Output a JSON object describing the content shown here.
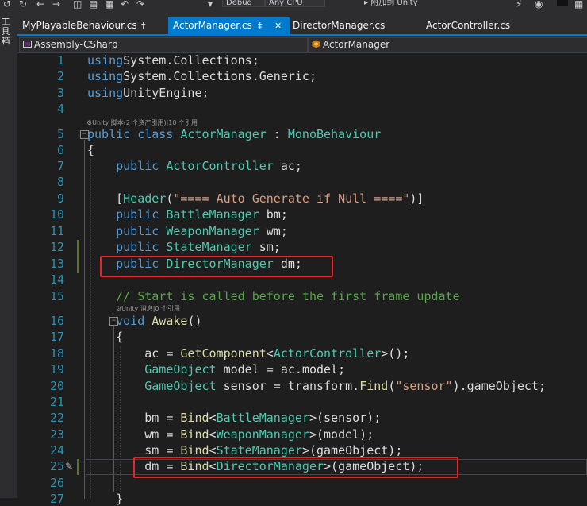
{
  "toolbar": {
    "config_value": "Debug",
    "platform_value": "Any CPU",
    "attach_label": "▸ 附加到 Unity"
  },
  "left_toolbox_label": "工具箱",
  "tabs": [
    {
      "label": "MyPlayableBehaviour.cs",
      "pin": "†",
      "active": false
    },
    {
      "label": "ActorManager.cs",
      "pin": "‡",
      "close": "✕",
      "active": true
    },
    {
      "label": "DirectorManager.cs",
      "active": false
    },
    {
      "label": "ActorController.cs",
      "active": false
    }
  ],
  "navbar": {
    "project": "Assembly-CSharp",
    "class": "ActorManager"
  },
  "codelens": {
    "class_refs": "⚙Unity 脚本(2 个资产引用)|10 个引用",
    "method_refs": "⚙Unity 消息|0 个引用"
  },
  "lines": [
    {
      "n": "1",
      "tokens": [
        [
          "kw",
          "using"
        ],
        [
          "",
          "System.Collections;"
        ]
      ]
    },
    {
      "n": "2",
      "tokens": [
        [
          "kw",
          "using"
        ],
        [
          "",
          "System.Collections.Generic;"
        ]
      ]
    },
    {
      "n": "3",
      "tokens": [
        [
          "kw",
          "using"
        ],
        [
          "",
          "UnityEngine;"
        ]
      ]
    },
    {
      "n": "4",
      "tokens": []
    },
    {
      "n": "5",
      "tokens": [
        [
          "kw",
          "public class"
        ],
        [
          "",
          " "
        ],
        [
          "ty",
          "ActorManager"
        ],
        [
          "",
          " : "
        ],
        [
          "ty",
          "MonoBehaviour"
        ]
      ]
    },
    {
      "n": "6",
      "tokens": [
        [
          "",
          "{"
        ]
      ]
    },
    {
      "n": "7",
      "tokens": [
        [
          "",
          "    "
        ],
        [
          "kw",
          "public"
        ],
        [
          "",
          " "
        ],
        [
          "ty",
          "ActorController"
        ],
        [
          "",
          " ac;"
        ]
      ]
    },
    {
      "n": "8",
      "tokens": []
    },
    {
      "n": "9",
      "tokens": [
        [
          "",
          "    ["
        ],
        [
          "ty",
          "Header"
        ],
        [
          "",
          "("
        ],
        [
          "st",
          "\"==== Auto Generate if Null ====\""
        ],
        [
          "",
          ")]"
        ]
      ]
    },
    {
      "n": "10",
      "tokens": [
        [
          "",
          "    "
        ],
        [
          "kw",
          "public"
        ],
        [
          "",
          " "
        ],
        [
          "ty",
          "BattleManager"
        ],
        [
          "",
          " bm;"
        ]
      ]
    },
    {
      "n": "11",
      "tokens": [
        [
          "",
          "    "
        ],
        [
          "kw",
          "public"
        ],
        [
          "",
          " "
        ],
        [
          "ty",
          "WeaponManager"
        ],
        [
          "",
          " wm;"
        ]
      ]
    },
    {
      "n": "12",
      "tokens": [
        [
          "",
          "    "
        ],
        [
          "kw",
          "public"
        ],
        [
          "",
          " "
        ],
        [
          "ty",
          "StateManager"
        ],
        [
          "",
          " sm;"
        ]
      ]
    },
    {
      "n": "13",
      "tokens": [
        [
          "",
          "    "
        ],
        [
          "kw",
          "public"
        ],
        [
          "",
          " "
        ],
        [
          "ty",
          "DirectorManager"
        ],
        [
          "",
          " dm;"
        ]
      ]
    },
    {
      "n": "14",
      "tokens": []
    },
    {
      "n": "15",
      "tokens": [
        [
          "",
          "    "
        ],
        [
          "cm",
          "// Start is called before the first frame update"
        ]
      ]
    },
    {
      "n": "16",
      "tokens": [
        [
          "",
          "    "
        ],
        [
          "kw",
          "void"
        ],
        [
          "",
          " "
        ],
        [
          "me",
          "Awake"
        ],
        [
          "",
          "()"
        ]
      ]
    },
    {
      "n": "17",
      "tokens": [
        [
          "",
          "    {"
        ]
      ]
    },
    {
      "n": "18",
      "tokens": [
        [
          "",
          "        ac = "
        ],
        [
          "me",
          "GetComponent"
        ],
        [
          "",
          "<"
        ],
        [
          "ty",
          "ActorController"
        ],
        [
          "",
          ">();"
        ]
      ]
    },
    {
      "n": "19",
      "tokens": [
        [
          "",
          "        "
        ],
        [
          "ty",
          "GameObject"
        ],
        [
          "",
          " model = ac.model;"
        ]
      ]
    },
    {
      "n": "20",
      "tokens": [
        [
          "",
          "        "
        ],
        [
          "ty",
          "GameObject"
        ],
        [
          "",
          " sensor = transform."
        ],
        [
          "me",
          "Find"
        ],
        [
          "",
          "("
        ],
        [
          "st",
          "\"sensor\""
        ],
        [
          "",
          ").gameObject;"
        ]
      ]
    },
    {
      "n": "21",
      "tokens": []
    },
    {
      "n": "22",
      "tokens": [
        [
          "",
          "        bm = "
        ],
        [
          "me",
          "Bind"
        ],
        [
          "",
          "<"
        ],
        [
          "ty",
          "BattleManager"
        ],
        [
          "",
          ">(sensor);"
        ]
      ]
    },
    {
      "n": "23",
      "tokens": [
        [
          "",
          "        wm = "
        ],
        [
          "me",
          "Bind"
        ],
        [
          "",
          "<"
        ],
        [
          "ty",
          "WeaponManager"
        ],
        [
          "",
          ">(model);"
        ]
      ]
    },
    {
      "n": "24",
      "tokens": [
        [
          "",
          "        sm = "
        ],
        [
          "me",
          "Bind"
        ],
        [
          "",
          "<"
        ],
        [
          "ty",
          "StateManager"
        ],
        [
          "",
          ">(gameObject);"
        ]
      ]
    },
    {
      "n": "25",
      "tokens": [
        [
          "",
          "        dm = "
        ],
        [
          "me",
          "Bind"
        ],
        [
          "",
          "<"
        ],
        [
          "ty",
          "DirectorManager"
        ],
        [
          "",
          ">(gameObject);"
        ]
      ]
    },
    {
      "n": "26",
      "tokens": []
    },
    {
      "n": "27",
      "tokens": [
        [
          "",
          "    }"
        ]
      ]
    }
  ]
}
